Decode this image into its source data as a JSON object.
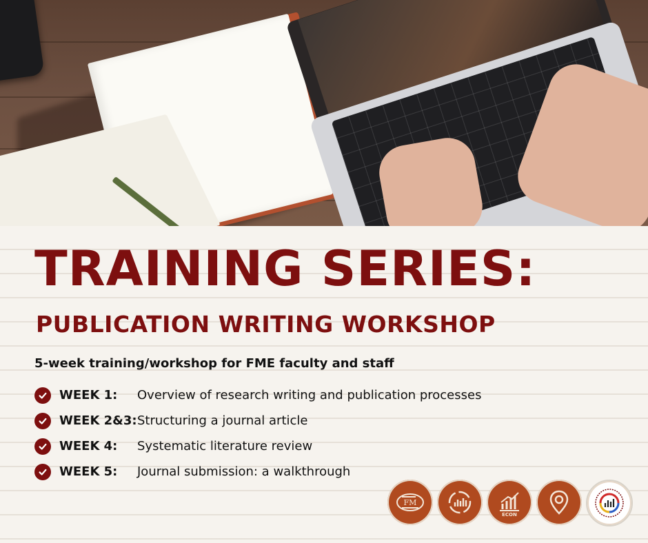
{
  "title": "TRAINING SERIES:",
  "subtitle": "PUBLICATION WRITING WORKSHOP",
  "tagline": "5-week training/workshop for FME faculty and staff",
  "schedule": [
    {
      "week": "WEEK 1:",
      "topic": "Overview of research writing and publication processes"
    },
    {
      "week": "WEEK 2&3:",
      "topic": "Structuring a journal article"
    },
    {
      "week": "WEEK 4:",
      "topic": "Systematic literature review"
    },
    {
      "week": "WEEK 5:",
      "topic": "Journal submission: a walkthrough"
    }
  ],
  "logos": [
    {
      "name": "fme-logo",
      "label": "FM"
    },
    {
      "name": "cycle-logo"
    },
    {
      "name": "econ-logo",
      "label": "ECON"
    },
    {
      "name": "location-pin-logo"
    },
    {
      "name": "research-office-seal"
    }
  ],
  "colors": {
    "accent": "#7d0f0f",
    "logo_bg": "#b04a1f",
    "paper": "#f6f3ee",
    "text": "#111111"
  },
  "icons": {
    "check": "check-circle-icon"
  }
}
